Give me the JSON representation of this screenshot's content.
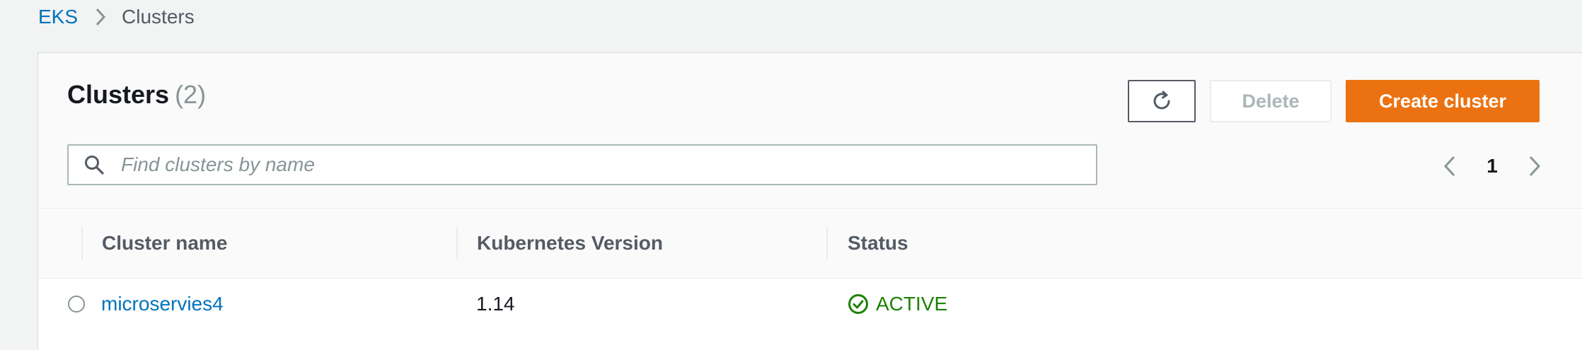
{
  "breadcrumb": {
    "root": "EKS",
    "current": "Clusters"
  },
  "header": {
    "title": "Clusters",
    "count": "(2)"
  },
  "actions": {
    "refresh_icon": "refresh-icon",
    "delete_label": "Delete",
    "create_label": "Create cluster"
  },
  "search": {
    "placeholder": "Find clusters by name",
    "value": ""
  },
  "pagination": {
    "current_page": "1"
  },
  "table": {
    "columns": [
      "Cluster name",
      "Kubernetes Version",
      "Status"
    ],
    "rows": [
      {
        "name": "microservies4",
        "version": "1.14",
        "status": "ACTIVE"
      }
    ]
  },
  "colors": {
    "primary": "#ec7211",
    "link": "#0073bb",
    "success": "#1d8102"
  }
}
